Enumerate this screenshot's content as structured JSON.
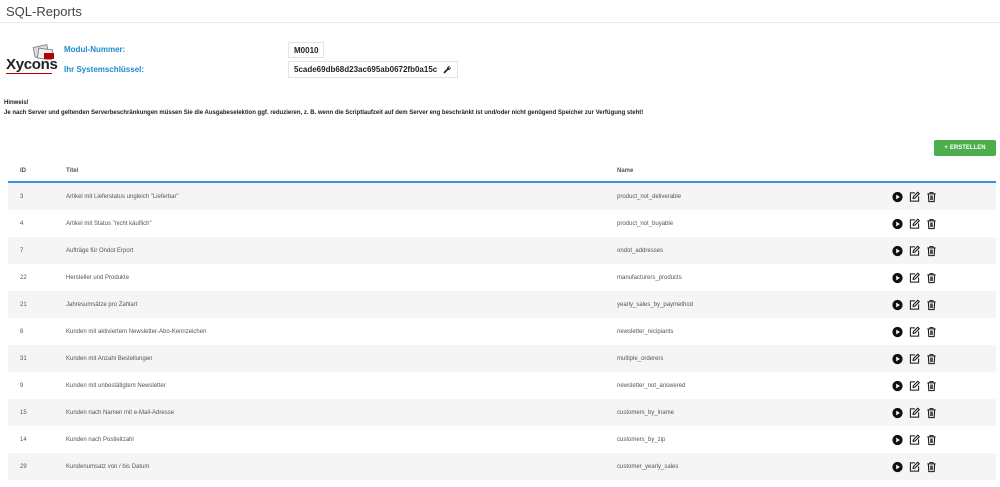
{
  "page": {
    "title": "SQL-Reports"
  },
  "logo": {
    "text": "Xycons"
  },
  "module": {
    "number_label": "Modul-Nummer:",
    "number_value": "M0010",
    "key_label": "Ihr Systemschlüssel:",
    "key_value": "5cade69db68d23ac695ab0672fb0a15c"
  },
  "hint": {
    "title": "Hinweis!",
    "text": "Je nach Server und geltenden Serverbeschränkungen müssen Sie die Ausgabeselektion ggf. reduzieren, z. B. wenn die Scriptlaufzeit auf dem Server eng beschränkt ist und/oder nicht genügend Speicher zur Verfügung steht!"
  },
  "toolbar": {
    "create_label": "ERSTELLEN"
  },
  "table": {
    "columns": {
      "id": "ID",
      "title": "Titel",
      "name": "Name"
    },
    "rows": [
      {
        "id": "3",
        "title": "Artikel mit Lieferstatus ungleich \"Lieferbar\"",
        "name": "product_not_deliverable"
      },
      {
        "id": "4",
        "title": "Artikel mit Status \"nicht käuflich\"",
        "name": "product_not_buyable"
      },
      {
        "id": "7",
        "title": "Aufträge für Ondot Erport",
        "name": "ondot_addresses"
      },
      {
        "id": "22",
        "title": "Hersteller und Produkte",
        "name": "manufacturers_products"
      },
      {
        "id": "21",
        "title": "Jahresumsätze pro Zahlart",
        "name": "yearly_sales_by_paymethod"
      },
      {
        "id": "8",
        "title": "Kunden mit aktiviertem Newsletter-Abo-Kennzeichen",
        "name": "newsletter_recipiants"
      },
      {
        "id": "31",
        "title": "Kunden mit Anzahl Bestellungen",
        "name": "multiple_orderers"
      },
      {
        "id": "9",
        "title": "Kunden mit unbestätigtem Newsletter",
        "name": "newsletter_not_answered"
      },
      {
        "id": "15",
        "title": "Kunden nach Namen mit e-Mail-Adresse",
        "name": "customers_by_lname"
      },
      {
        "id": "14",
        "title": "Kunden nach Postleitzahl",
        "name": "customers_by_zip"
      },
      {
        "id": "29",
        "title": "Kundenumsatz von / bis Datum",
        "name": "customer_yearly_sales"
      }
    ]
  },
  "icons": {
    "run": "play-icon",
    "edit": "edit-icon",
    "delete": "trash-icon",
    "key": "wrench-icon",
    "add": "plus-icon"
  },
  "colors": {
    "accent": "#1a8ccf",
    "create": "#4cae4c",
    "header_rule": "#3a8ee6"
  }
}
